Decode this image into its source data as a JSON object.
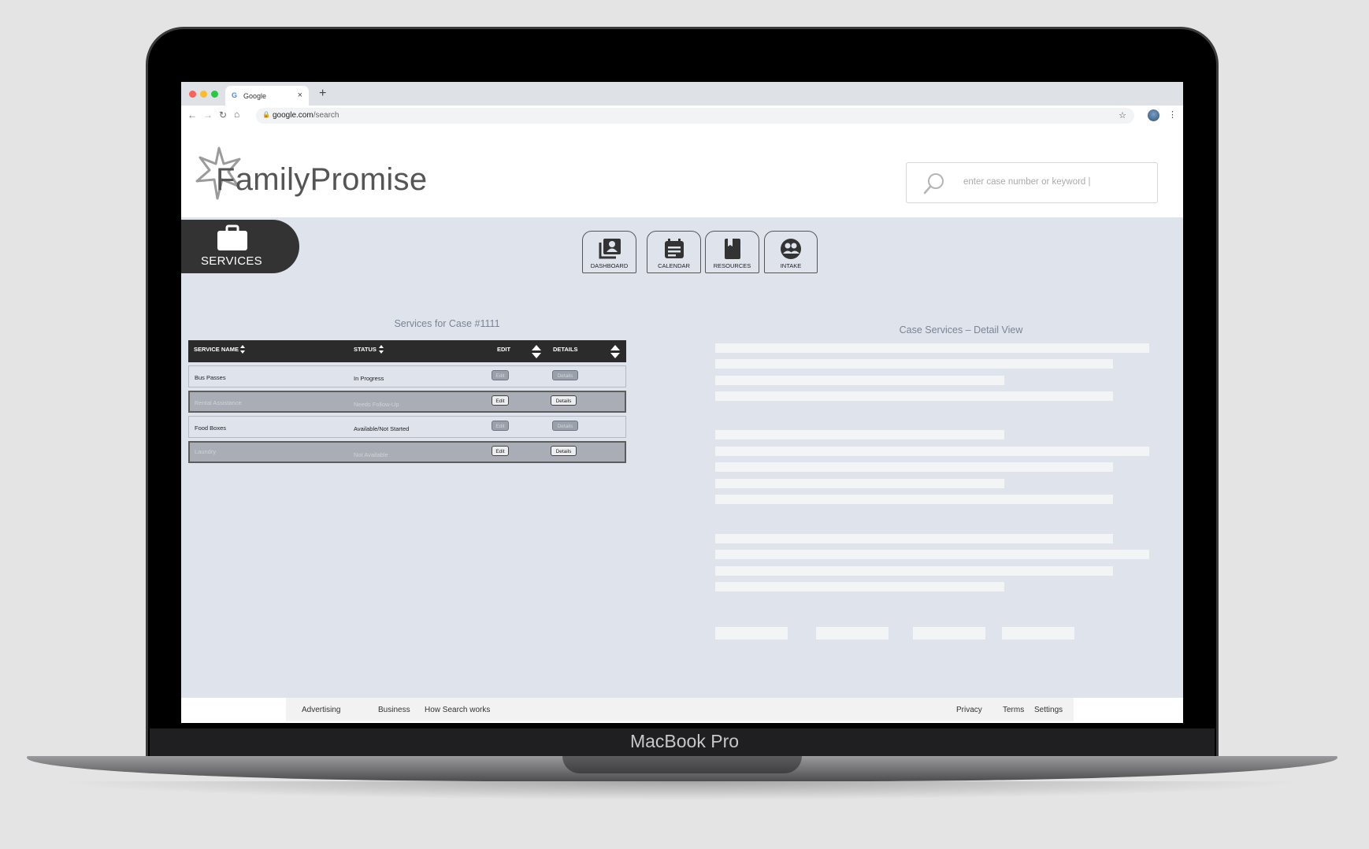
{
  "device": {
    "label": "MacBook Pro"
  },
  "browser": {
    "tab_title": "Google",
    "tab_favicon": "G",
    "tab_close": "×",
    "new_tab": "+",
    "url_host": "google.com",
    "url_path": "/search"
  },
  "app": {
    "logo_text": "FamilyPromise",
    "search_placeholder": "enter case number or keyword |",
    "section_label": "SERVICES",
    "nav": [
      {
        "label": "DASHBOARD",
        "icon": "dashboard-icon"
      },
      {
        "label": "CALENDAR",
        "icon": "calendar-icon"
      },
      {
        "label": "RESOURCES",
        "icon": "resources-icon"
      },
      {
        "label": "INTAKE",
        "icon": "intake-icon"
      }
    ],
    "table": {
      "title": "Services for Case #1111",
      "headers": {
        "name": "SERVICE NAME",
        "status": "STATUS",
        "edit": "EDIT",
        "details": "DETAILS"
      },
      "rows": [
        {
          "name": "Bus Passes",
          "status": "In Progress",
          "edit": "Edit",
          "details": "Details"
        },
        {
          "name": "Rental Assistance",
          "status": "Needs Follow-Up",
          "edit": "Edit",
          "details": "Details"
        },
        {
          "name": "Food Boxes",
          "status": "Available/Not Started",
          "edit": "Edit",
          "details": "Details"
        },
        {
          "name": "Laundry",
          "status": "Not Available",
          "edit": "Edit",
          "details": "Details"
        }
      ]
    },
    "detail_title": "Case Services – Detail View"
  },
  "footer": {
    "left": [
      "Advertising",
      "Business",
      "How Search works"
    ],
    "right": [
      "Privacy",
      "Terms",
      "Settings"
    ]
  },
  "colors": {
    "dark": "#333333",
    "panel": "#dfe4ec",
    "placeholder": "#f3f4f6"
  }
}
